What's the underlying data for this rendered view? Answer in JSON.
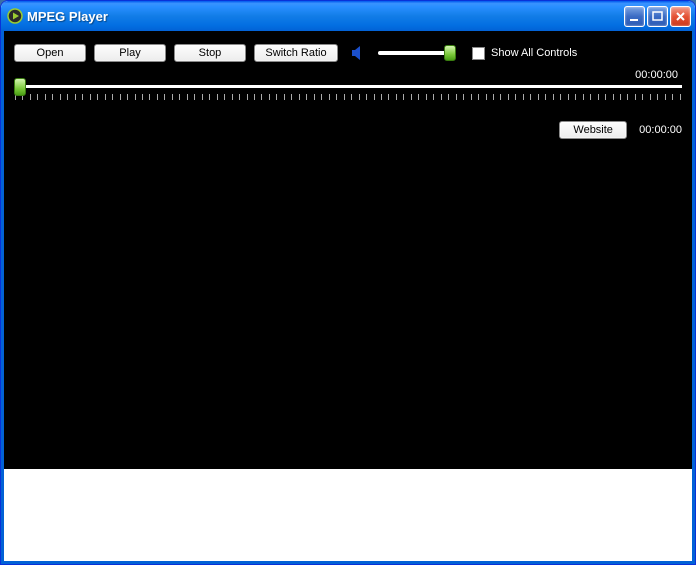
{
  "window": {
    "title": "MPEG Player"
  },
  "toolbar": {
    "open_label": "Open",
    "play_label": "Play",
    "stop_label": "Stop",
    "switch_ratio_label": "Switch Ratio",
    "show_all_controls_label": "Show All Controls",
    "show_all_controls_checked": false,
    "volume_percent": 100
  },
  "player": {
    "duration_display": "00:00:00",
    "position_display": "00:00:00",
    "position_percent": 0,
    "website_label": "Website"
  },
  "colors": {
    "titlebar_blue": "#127de7",
    "close_red": "#e55235",
    "slider_green": "#7bc93a",
    "client_bg": "#000000"
  }
}
